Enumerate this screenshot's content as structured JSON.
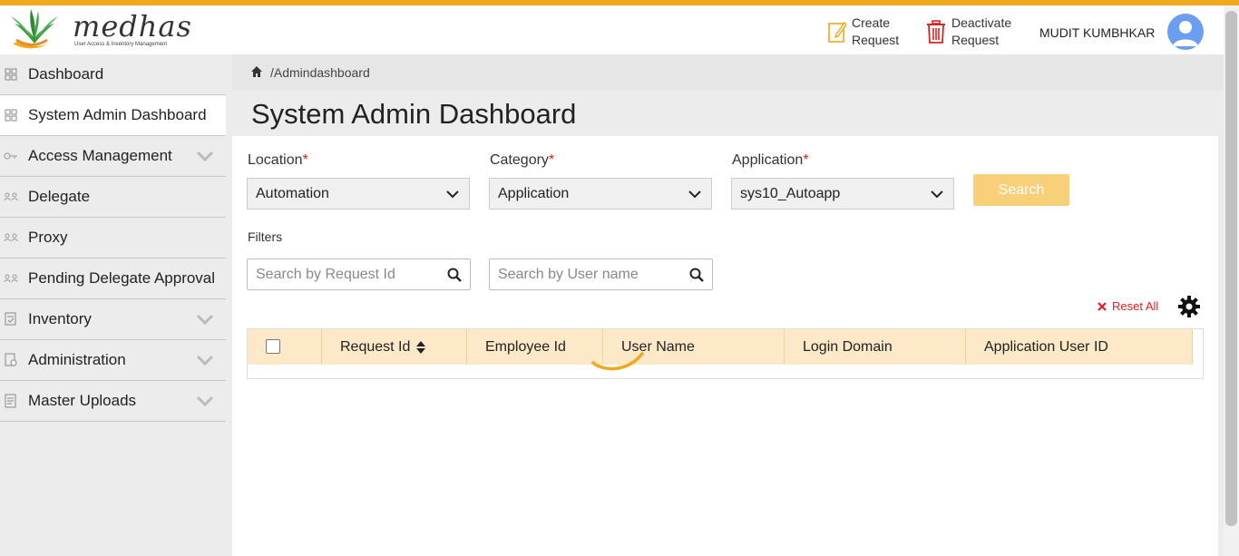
{
  "brand": {
    "name": "medhas",
    "tagline": "User Access & Inventory Management"
  },
  "header": {
    "create_label_1": "Create",
    "create_label_2": "Request",
    "deactivate_label_1": "Deactivate",
    "deactivate_label_2": "Request",
    "user_name": "MUDIT KUMBHKAR"
  },
  "sidebar": {
    "items": [
      {
        "label": "Dashboard",
        "icon": "grid-icon"
      },
      {
        "label": "System Admin Dashboard",
        "icon": "grid-icon",
        "active": true
      },
      {
        "label": "Access Management",
        "icon": "key-icon",
        "expandable": true
      },
      {
        "label": "Delegate",
        "icon": "users-icon"
      },
      {
        "label": "Proxy",
        "icon": "users-icon"
      },
      {
        "label": "Pending Delegate Approval",
        "icon": "users-icon"
      },
      {
        "label": "Inventory",
        "icon": "clipboard-icon",
        "expandable": true
      },
      {
        "label": "Administration",
        "icon": "document-gear-icon",
        "expandable": true
      },
      {
        "label": "Master Uploads",
        "icon": "document-icon",
        "expandable": true
      }
    ]
  },
  "breadcrumb": {
    "path": "/Admindashboard"
  },
  "page": {
    "title": "System Admin Dashboard"
  },
  "form": {
    "location": {
      "label": "Location",
      "required_mark": "*",
      "value": "Automation"
    },
    "category": {
      "label": "Category",
      "required_mark": "*",
      "value": "Application"
    },
    "application": {
      "label": "Application",
      "required_mark": "*",
      "value": "sys10_Autoapp"
    },
    "search_label": "Search"
  },
  "filters": {
    "label": "Filters",
    "request_id_placeholder": "Search by Request Id",
    "user_name_placeholder": "Search by User name",
    "reset_label": "Reset All"
  },
  "table": {
    "columns": [
      "Request Id",
      "Employee Id",
      "User Name",
      "Login Domain",
      "Application User ID"
    ]
  },
  "colors": {
    "accent": "#f0a81c",
    "search_button": "#f8d07a",
    "table_header": "#fde8c8",
    "required": "#dd2222"
  }
}
